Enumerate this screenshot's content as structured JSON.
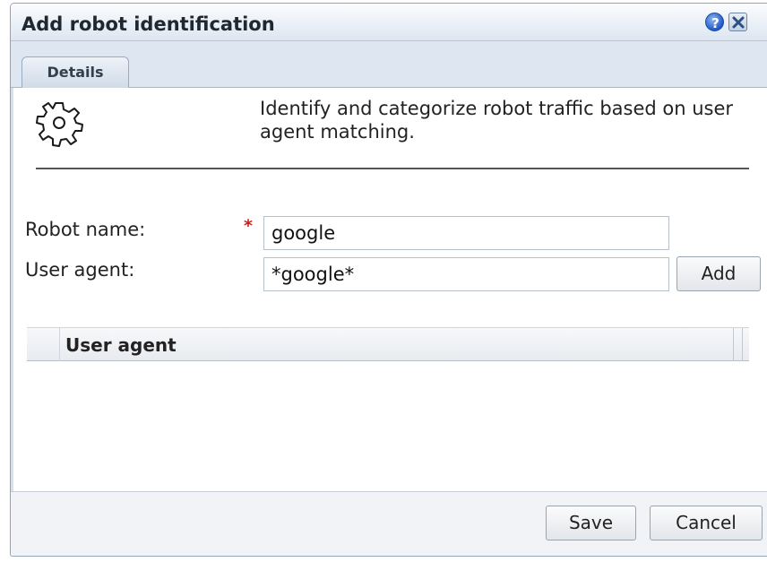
{
  "dialog": {
    "title": "Add robot identification",
    "icons": {
      "help": "help-icon",
      "close": "close-icon",
      "header": "gear-icon"
    }
  },
  "tabs": [
    {
      "label": "Details",
      "selected": true
    }
  ],
  "description": "Identify and categorize robot traffic based on user agent matching.",
  "form": {
    "robot_name": {
      "label": "Robot name:",
      "required_marker": "*",
      "value": "google"
    },
    "user_agent": {
      "label": "User agent:",
      "value": "*google*",
      "add_label": "Add"
    }
  },
  "grid": {
    "columns": [
      "User agent"
    ],
    "rows": []
  },
  "footer": {
    "save_label": "Save",
    "cancel_label": "Cancel"
  },
  "colors": {
    "required": "#d11a1a",
    "titlebar": "#dde6f1",
    "border": "#8fa4bd"
  }
}
